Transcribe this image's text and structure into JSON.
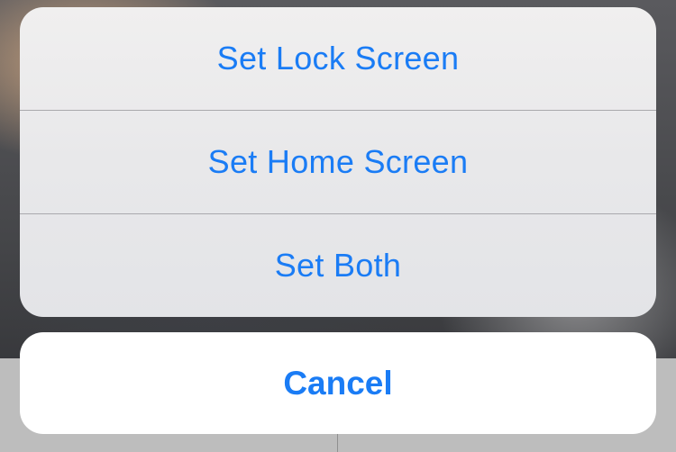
{
  "action_sheet": {
    "options": [
      {
        "label": "Set Lock Screen"
      },
      {
        "label": "Set Home Screen"
      },
      {
        "label": "Set Both"
      }
    ],
    "cancel_label": "Cancel"
  },
  "colors": {
    "accent": "#1a7cf5",
    "sheet_background": "#ececee",
    "cancel_background": "#ffffff"
  }
}
